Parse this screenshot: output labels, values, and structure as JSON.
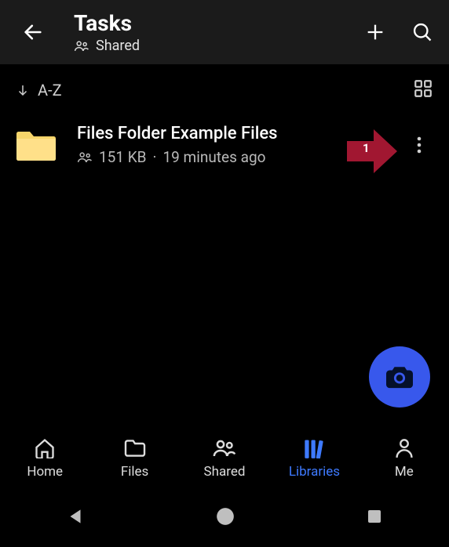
{
  "header": {
    "title": "Tasks",
    "subtitle": "Shared"
  },
  "sort": {
    "mode": "A-Z"
  },
  "items": [
    {
      "name": "Files Folder Example Files",
      "size": "151 KB",
      "modified": "19 minutes ago"
    }
  ],
  "callout": {
    "label": "1"
  },
  "nav": {
    "home": "Home",
    "files": "Files",
    "shared": "Shared",
    "libraries": "Libraries",
    "me": "Me",
    "active": "libraries"
  },
  "colors": {
    "accent": "#3e7aff",
    "fab": "#3858ec",
    "callout": "#a11731"
  }
}
